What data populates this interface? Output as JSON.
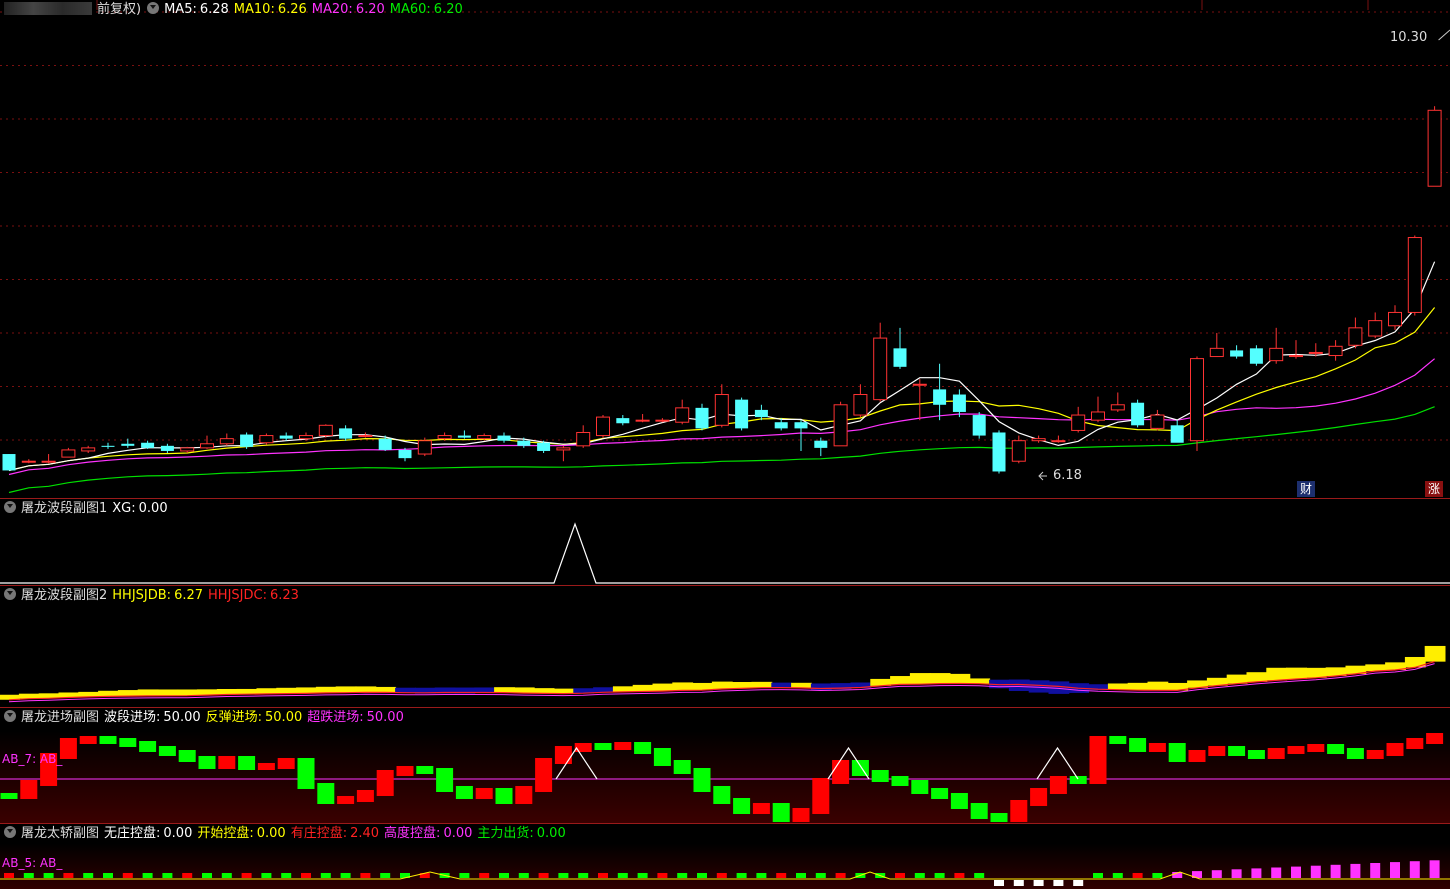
{
  "main": {
    "header": {
      "adjust": "前复权)",
      "ma5_label": "MA5:",
      "ma5": "6.28",
      "ma10_label": "MA10:",
      "ma10": "6.26",
      "ma20_label": "MA20:",
      "ma20": "6.20",
      "ma60_label": "MA60:",
      "ma60": "6.20"
    },
    "high_label": "10.30",
    "low_label": "6.18",
    "badge_finance": "财",
    "badge_limit": "涨"
  },
  "sub1": {
    "title": "屠龙波段副图1",
    "xg_label": "XG:",
    "xg": "0.00"
  },
  "sub2": {
    "title": "屠龙波段副图2",
    "a_label": "HHJSJDB:",
    "a": "6.27",
    "b_label": "HHJSJDC:",
    "b": "6.23"
  },
  "sub3": {
    "title": "屠龙进场副图",
    "a_label": "波段进场:",
    "a": "50.00",
    "b_label": "反弹进场:",
    "b": "50.00",
    "c_label": "超跌进场:",
    "c": "50.00",
    "side_label": "AB_7: AB_"
  },
  "sub4": {
    "title": "屠龙太轿副图",
    "a_label": "无庄控盘:",
    "a": "0.00",
    "b_label": "开始控盘:",
    "b": "0.00",
    "c_label": "有庄控盘:",
    "c": "2.40",
    "d_label": "高度控盘:",
    "d": "0.00",
    "e_label": "主力出货:",
    "e": "0.00",
    "side_label": "AB_5: AB_"
  },
  "colors": {
    "up": "#ff3333",
    "down": "#54ffff",
    "ma5": "#ffffff",
    "ma10": "#ffff00",
    "ma20": "#ff33ff",
    "ma60": "#00e000",
    "grid": "#7a1010",
    "bar_red": "#ff0000",
    "bar_green": "#00ff00"
  },
  "chart_data": {
    "type": "candlestick",
    "ylim": [
      6.0,
      10.6
    ],
    "candles": [
      [
        6.37,
        6.21,
        6.37,
        6.21
      ],
      [
        6.3,
        6.3,
        6.32,
        6.28
      ],
      [
        6.3,
        6.3,
        6.37,
        6.28
      ],
      [
        6.34,
        6.41,
        6.43,
        6.34
      ],
      [
        6.4,
        6.43,
        6.45,
        6.38
      ],
      [
        6.45,
        6.44,
        6.48,
        6.42
      ],
      [
        6.47,
        6.45,
        6.52,
        6.43
      ],
      [
        6.48,
        6.43,
        6.5,
        6.42
      ],
      [
        6.45,
        6.4,
        6.47,
        6.38
      ],
      [
        6.4,
        6.43,
        6.44,
        6.38
      ],
      [
        6.43,
        6.47,
        6.55,
        6.42
      ],
      [
        6.47,
        6.52,
        6.57,
        6.45
      ],
      [
        6.56,
        6.44,
        6.58,
        6.42
      ],
      [
        6.48,
        6.55,
        6.57,
        6.46
      ],
      [
        6.55,
        6.52,
        6.58,
        6.5
      ],
      [
        6.52,
        6.55,
        6.58,
        6.5
      ],
      [
        6.55,
        6.65,
        6.66,
        6.53
      ],
      [
        6.62,
        6.52,
        6.65,
        6.5
      ],
      [
        6.55,
        6.55,
        6.58,
        6.53
      ],
      [
        6.52,
        6.41,
        6.55,
        6.4
      ],
      [
        6.41,
        6.33,
        6.43,
        6.3
      ],
      [
        6.37,
        6.5,
        6.53,
        6.35
      ],
      [
        6.52,
        6.55,
        6.58,
        6.5
      ],
      [
        6.55,
        6.53,
        6.6,
        6.52
      ],
      [
        6.52,
        6.55,
        6.57,
        6.5
      ],
      [
        6.55,
        6.5,
        6.58,
        6.48
      ],
      [
        6.5,
        6.45,
        6.53,
        6.43
      ],
      [
        6.48,
        6.4,
        6.5,
        6.38
      ],
      [
        6.41,
        6.43,
        6.45,
        6.3
      ],
      [
        6.45,
        6.58,
        6.65,
        6.43
      ],
      [
        6.55,
        6.73,
        6.75,
        6.53
      ],
      [
        6.72,
        6.67,
        6.75,
        6.65
      ],
      [
        6.7,
        6.7,
        6.76,
        6.68
      ],
      [
        6.7,
        6.7,
        6.72,
        6.68
      ],
      [
        6.68,
        6.82,
        6.9,
        6.66
      ],
      [
        6.82,
        6.62,
        6.86,
        6.6
      ],
      [
        6.65,
        6.95,
        7.05,
        6.63
      ],
      [
        6.9,
        6.62,
        6.92,
        6.6
      ],
      [
        6.8,
        6.73,
        6.85,
        6.7
      ],
      [
        6.68,
        6.62,
        6.72,
        6.6
      ],
      [
        6.68,
        6.62,
        6.7,
        6.4
      ],
      [
        6.5,
        6.43,
        6.53,
        6.35
      ],
      [
        6.45,
        6.85,
        6.88,
        6.45
      ],
      [
        6.75,
        6.95,
        7.05,
        6.73
      ],
      [
        6.9,
        7.5,
        7.65,
        6.88
      ],
      [
        7.4,
        7.22,
        7.6,
        7.2
      ],
      [
        7.05,
        7.05,
        7.1,
        6.7
      ],
      [
        7.0,
        6.85,
        7.25,
        6.7
      ],
      [
        6.95,
        6.78,
        7.0,
        6.73
      ],
      [
        6.75,
        6.55,
        6.78,
        6.52
      ],
      [
        6.58,
        6.2,
        6.6,
        6.18
      ],
      [
        6.3,
        6.5,
        6.55,
        6.28
      ],
      [
        6.5,
        6.52,
        6.55,
        6.48
      ],
      [
        6.5,
        6.5,
        6.55,
        6.48
      ],
      [
        6.6,
        6.75,
        6.83,
        6.58
      ],
      [
        6.7,
        6.78,
        6.93,
        6.68
      ],
      [
        6.8,
        6.85,
        6.97,
        6.78
      ],
      [
        6.87,
        6.65,
        6.9,
        6.63
      ],
      [
        6.62,
        6.75,
        6.8,
        6.6
      ],
      [
        6.65,
        6.48,
        6.7,
        6.5
      ],
      [
        6.5,
        7.3,
        7.32,
        6.4
      ],
      [
        7.32,
        7.4,
        7.55,
        7.35
      ],
      [
        7.38,
        7.32,
        7.43,
        7.3
      ],
      [
        7.4,
        7.25,
        7.43,
        7.23
      ],
      [
        7.28,
        7.4,
        7.6,
        7.25
      ],
      [
        7.33,
        7.33,
        7.48,
        7.3
      ],
      [
        7.36,
        7.36,
        7.45,
        7.32
      ],
      [
        7.33,
        7.42,
        7.48,
        7.28
      ],
      [
        7.43,
        7.6,
        7.7,
        7.4
      ],
      [
        7.52,
        7.67,
        7.75,
        7.5
      ],
      [
        7.62,
        7.75,
        7.82,
        7.58
      ],
      [
        7.75,
        8.48,
        8.5,
        7.72
      ],
      [
        8.98,
        9.72,
        9.76,
        9.48
      ]
    ]
  }
}
